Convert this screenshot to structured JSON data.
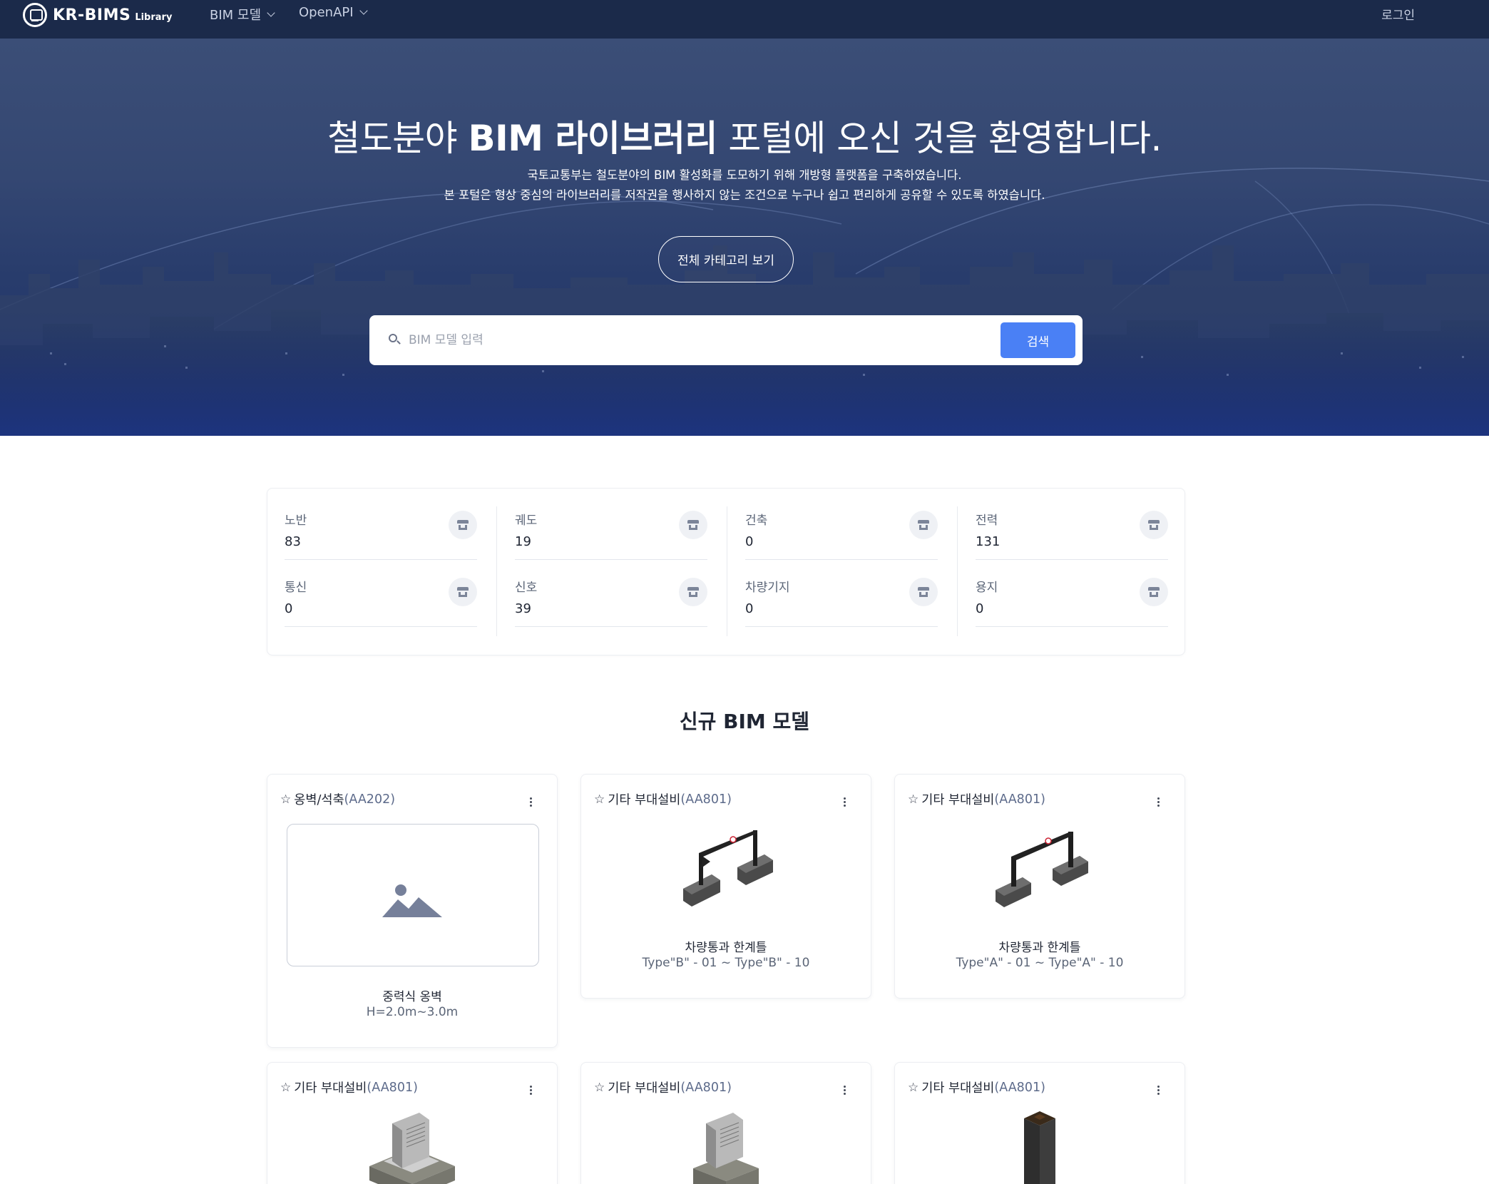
{
  "nav": {
    "logo_text": "KR-BIMS",
    "logo_sub": "Library",
    "menu": [
      {
        "label": "BIM 모델"
      },
      {
        "label": "OpenAPI"
      }
    ],
    "login": "로그인"
  },
  "hero": {
    "title_pre": "철도분야 ",
    "title_bold": "BIM 라이브러리",
    "title_post": " 포털에 오신 것을 환영합니다.",
    "desc_line1": "국토교통부는 철도분야의 BIM 활성화를 도모하기 위해 개방형 플랫폼을 구축하였습니다.",
    "desc_line2": "본 포털은 형상 중심의 라이브러리를 저작권을 행사하지 않는 조건으로 누구나 쉽고 편리하게 공유할 수 있도록 하였습니다.",
    "category_button": "전체 카테고리 보기",
    "search_placeholder": "BIM 모델 입력",
    "search_button": "검색"
  },
  "stats": [
    {
      "label": "노반",
      "value": "83"
    },
    {
      "label": "궤도",
      "value": "19"
    },
    {
      "label": "건축",
      "value": "0"
    },
    {
      "label": "전력",
      "value": "131"
    },
    {
      "label": "통신",
      "value": "0"
    },
    {
      "label": "신호",
      "value": "39"
    },
    {
      "label": "차량기지",
      "value": "0"
    },
    {
      "label": "용지",
      "value": "0"
    }
  ],
  "section_title": "신규 BIM 모델",
  "cards": [
    {
      "category": "옹벽/석축",
      "code": "(AA202)",
      "name": "중력식 옹벽",
      "spec": "H=2.0m~3.0m",
      "image": "image-placeholder-icon"
    },
    {
      "category": "기타 부대설비",
      "code": "(AA801)",
      "name": "차량통과 한계틀",
      "spec": "Type\"B\" - 01 ~ Type\"B\" - 10",
      "image": "clearance-gate-model"
    },
    {
      "category": "기타 부대설비",
      "code": "(AA801)",
      "name": "차량통과 한계틀",
      "spec": "Type\"A\" - 01 ~ Type\"A\" - 10",
      "image": "clearance-gate-model"
    },
    {
      "category": "기타 부대설비",
      "code": "(AA801)",
      "name": "",
      "spec": "",
      "image": "monument-stone-model"
    },
    {
      "category": "기타 부대설비",
      "code": "(AA801)",
      "name": "",
      "spec": "",
      "image": "monument-stone-model"
    },
    {
      "category": "기타 부대설비",
      "code": "(AA801)",
      "name": "",
      "spec": "",
      "image": "stone-pillar-model"
    }
  ]
}
